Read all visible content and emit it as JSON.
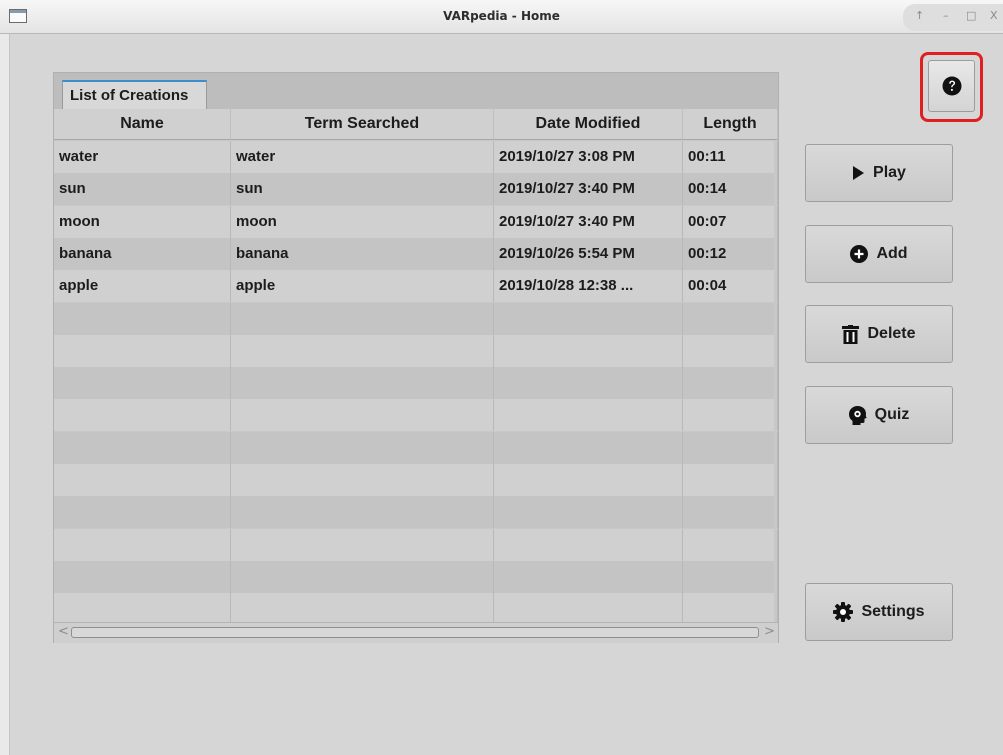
{
  "window": {
    "title": "VARpedia - Home"
  },
  "title_controls": {
    "pin": "↑",
    "minimize": "–",
    "maximize": "□",
    "close": "X"
  },
  "tab": {
    "label": "List of Creations"
  },
  "table": {
    "columns": [
      "Name",
      "Term Searched",
      "Date Modified",
      "Length"
    ],
    "rows": [
      [
        "water",
        "water",
        "2019/10/27 3:08 PM",
        "00:11"
      ],
      [
        "sun",
        "sun",
        "2019/10/27 3:40 PM",
        "00:14"
      ],
      [
        "moon",
        "moon",
        "2019/10/27 3:40 PM",
        "00:07"
      ],
      [
        "banana",
        "banana",
        "2019/10/26 5:54 PM",
        "00:12"
      ],
      [
        "apple",
        "apple",
        "2019/10/28 12:38 ...",
        "00:04"
      ]
    ],
    "empty_rows": 10
  },
  "scrollbar": {
    "left_arrow": "<",
    "right_arrow": ">"
  },
  "buttons": {
    "help_icon": "question-circle-icon",
    "play": {
      "label": "Play",
      "icon": "play-icon"
    },
    "add": {
      "label": "Add",
      "icon": "plus-circle-icon"
    },
    "delete": {
      "label": "Delete",
      "icon": "trash-icon"
    },
    "quiz": {
      "label": "Quiz",
      "icon": "head-gear-icon"
    },
    "settings": {
      "label": "Settings",
      "icon": "gear-icon"
    }
  },
  "colors": {
    "highlight": "#e02020",
    "tab_accent": "#3b8fc8"
  }
}
